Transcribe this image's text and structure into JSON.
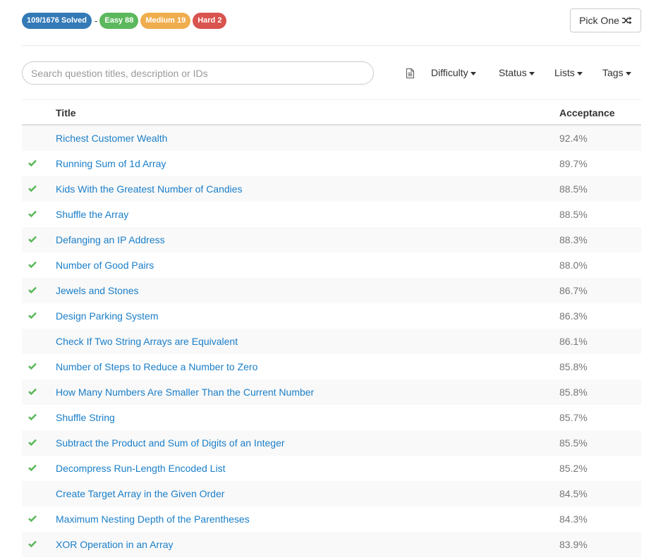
{
  "header": {
    "solved_label": "109/1676 Solved",
    "separator": "-",
    "easy_label": "Easy 88",
    "medium_label": "Medium 19",
    "hard_label": "Hard 2",
    "pick_one_label": "Pick One",
    "pick_one_icon": "random-shuffle-icon"
  },
  "search": {
    "placeholder": "Search question titles, description or IDs"
  },
  "filters": {
    "doc_icon": "file-document-icon",
    "difficulty": "Difficulty",
    "status": "Status",
    "lists": "Lists",
    "tags": "Tags"
  },
  "colors": {
    "solved": "#337ab7",
    "easy": "#5cb85c",
    "medium": "#f0ad4e",
    "hard": "#d9534f",
    "link": "#1a7ec8",
    "check": "#5cb85c"
  },
  "table": {
    "col_title": "Title",
    "col_acceptance": "Acceptance",
    "rows": [
      {
        "title": "Richest Customer Wealth",
        "acceptance": "92.4%",
        "solved": false
      },
      {
        "title": "Running Sum of 1d Array",
        "acceptance": "89.7%",
        "solved": true
      },
      {
        "title": "Kids With the Greatest Number of Candies",
        "acceptance": "88.5%",
        "solved": true
      },
      {
        "title": "Shuffle the Array",
        "acceptance": "88.5%",
        "solved": true
      },
      {
        "title": "Defanging an IP Address",
        "acceptance": "88.3%",
        "solved": true
      },
      {
        "title": "Number of Good Pairs",
        "acceptance": "88.0%",
        "solved": true
      },
      {
        "title": "Jewels and Stones",
        "acceptance": "86.7%",
        "solved": true
      },
      {
        "title": "Design Parking System",
        "acceptance": "86.3%",
        "solved": true
      },
      {
        "title": "Check If Two String Arrays are Equivalent",
        "acceptance": "86.1%",
        "solved": false
      },
      {
        "title": "Number of Steps to Reduce a Number to Zero",
        "acceptance": "85.8%",
        "solved": true
      },
      {
        "title": "How Many Numbers Are Smaller Than the Current Number",
        "acceptance": "85.8%",
        "solved": true
      },
      {
        "title": "Shuffle String",
        "acceptance": "85.7%",
        "solved": true
      },
      {
        "title": "Subtract the Product and Sum of Digits of an Integer",
        "acceptance": "85.5%",
        "solved": true
      },
      {
        "title": "Decompress Run-Length Encoded List",
        "acceptance": "85.2%",
        "solved": true
      },
      {
        "title": "Create Target Array in the Given Order",
        "acceptance": "84.5%",
        "solved": false
      },
      {
        "title": "Maximum Nesting Depth of the Parentheses",
        "acceptance": "84.3%",
        "solved": true
      },
      {
        "title": "XOR Operation in an Array",
        "acceptance": "83.9%",
        "solved": true
      }
    ]
  }
}
